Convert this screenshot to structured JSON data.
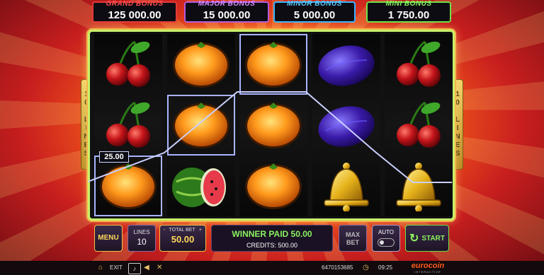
{
  "jackpots": {
    "grand": {
      "label": "GRAND BONUS",
      "value": "125 000.00"
    },
    "major": {
      "label": "MAJOR BONUS",
      "value": "15 000.00"
    },
    "minor": {
      "label": "MINOR BONUS",
      "value": "5 000.00"
    },
    "mini": {
      "label": "MINI BONUS",
      "value": "1 750.00"
    }
  },
  "lines_indicator": "10 LINES",
  "reels": [
    [
      "cherry",
      "cherry",
      "orange"
    ],
    [
      "orange",
      "orange",
      "watermelon"
    ],
    [
      "orange",
      "orange",
      "orange"
    ],
    [
      "plum",
      "plum",
      "bell"
    ],
    [
      "cherry",
      "cherry",
      "bell"
    ]
  ],
  "win_amount_label": "25.00",
  "controls": {
    "menu": "MENU",
    "lines_label": "LINES",
    "lines_value": "10",
    "bet_minus": "-",
    "bet_label": "TOTAL BET",
    "bet_plus": "+",
    "bet_value": "50.00",
    "winner_text": "WINNER PAID 50.00",
    "credits_text": "CREDITS: 500.00",
    "max_bet_line1": "MAX",
    "max_bet_line2": "BET",
    "auto_label": "AUTO",
    "start": "START"
  },
  "statusbar": {
    "exit": "EXIT",
    "ticket": "6470153685",
    "time": "09:25",
    "brand": "eurocoin",
    "brand_sub": "INTERACTIVE"
  },
  "icons": {
    "home": "home-icon",
    "volume": "speaker-icon",
    "clock": "clock-icon",
    "start": "refresh-icon"
  }
}
